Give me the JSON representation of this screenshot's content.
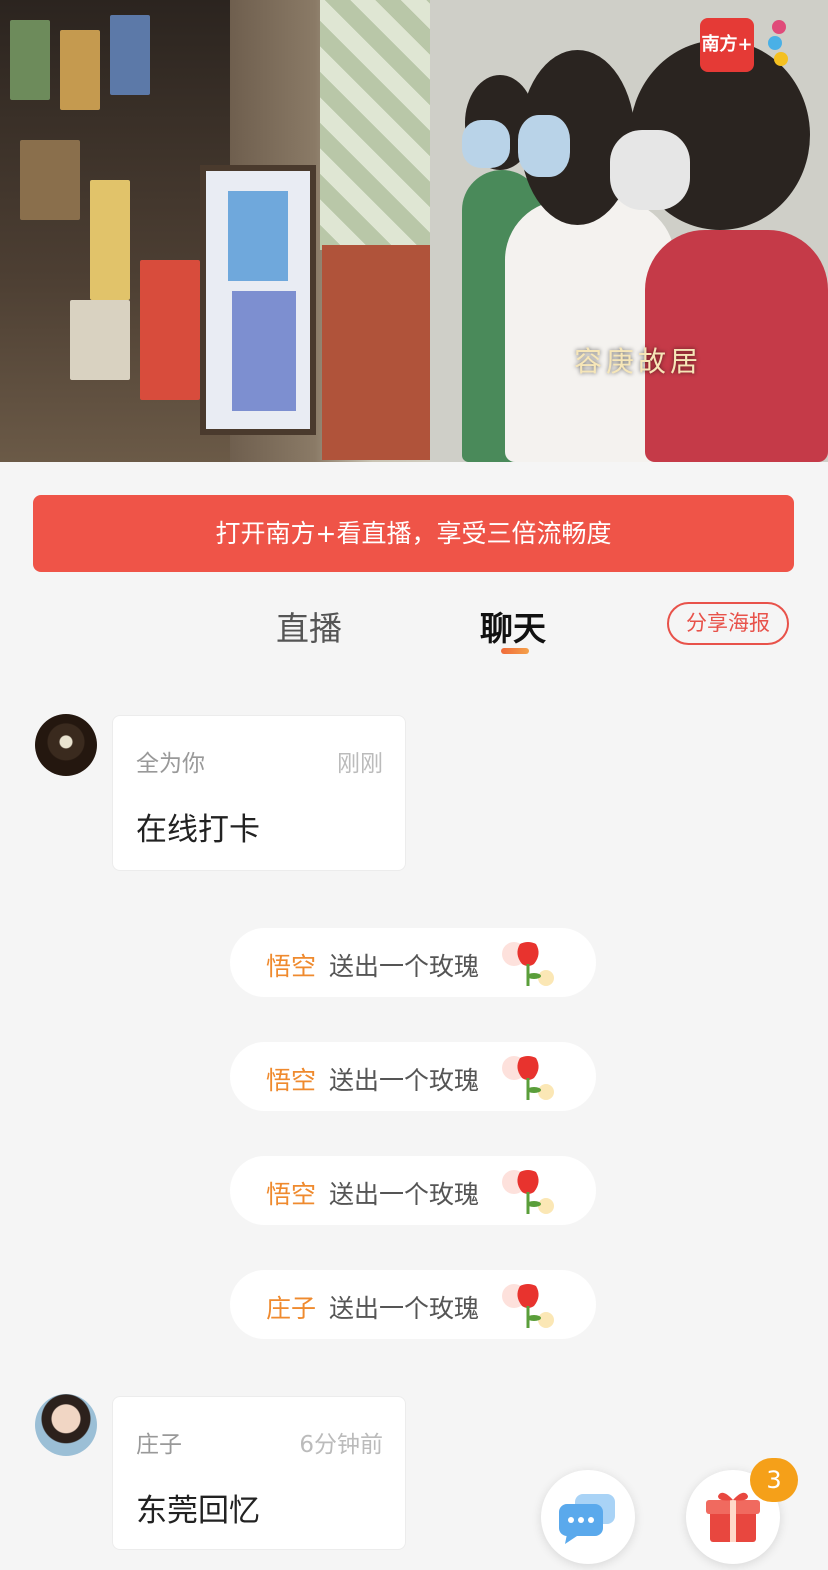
{
  "video": {
    "location_caption": "容庚故居",
    "logo_text": "南方+"
  },
  "banner": {
    "text": "打开南方+看直播，享受三倍流畅度"
  },
  "tabs": [
    {
      "label": "直播",
      "active": false
    },
    {
      "label": "聊天",
      "active": true
    }
  ],
  "share_button": "分享海报",
  "messages": [
    {
      "user": "全为你",
      "time": "刚刚",
      "text": "在线打卡"
    },
    {
      "user": "庄子",
      "time": "6分钟前",
      "text": "东莞回忆"
    }
  ],
  "gifts": [
    {
      "user": "悟空",
      "text": "送出一个玫瑰",
      "icon": "rose-icon"
    },
    {
      "user": "悟空",
      "text": "送出一个玫瑰",
      "icon": "rose-icon"
    },
    {
      "user": "悟空",
      "text": "送出一个玫瑰",
      "icon": "rose-icon"
    },
    {
      "user": "庄子",
      "text": "送出一个玫瑰",
      "icon": "rose-icon"
    }
  ],
  "floating": {
    "chat_icon": "chat-bubbles-icon",
    "gift_icon": "gift-box-icon",
    "gift_badge": "3"
  },
  "colors": {
    "accent": "#ef5448",
    "gift_user": "#ef8a2e",
    "badge": "#f5a019"
  }
}
